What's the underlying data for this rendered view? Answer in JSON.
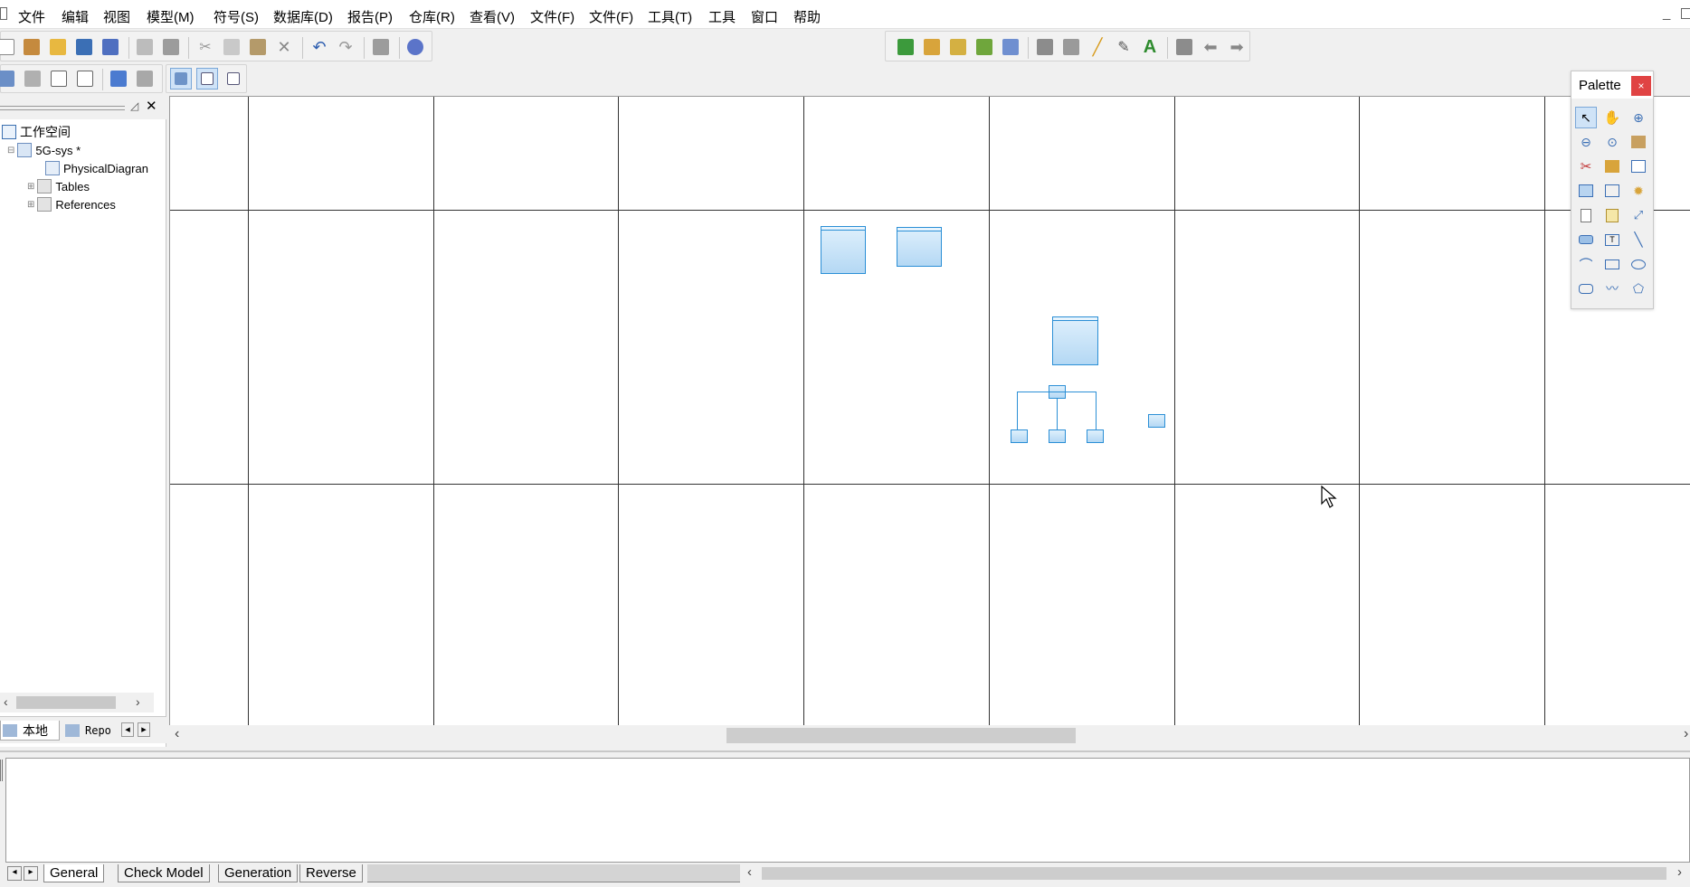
{
  "menu": {
    "items": [
      "文件",
      "编辑",
      "视图",
      "模型(M)",
      "符号(S)",
      "数据库(D)",
      "报告(P)",
      "仓库(R)",
      "查看(V)",
      "文件(F)",
      "文件(F)",
      "工具(T)",
      "工具",
      "窗口",
      "帮助"
    ],
    "minimize": "_"
  },
  "browser": {
    "tree": {
      "workspace": "工作空间",
      "model": "5G-sys *",
      "diagram": "PhysicalDiagran",
      "tables": "Tables",
      "references": "References"
    },
    "tabs": {
      "local": "本地",
      "repo": "Repo"
    }
  },
  "palette": {
    "title": "Palette",
    "close": "×"
  },
  "output": {
    "tabs": [
      "General",
      "Check Model",
      "Generation",
      "Reverse"
    ]
  },
  "colors": {
    "table_border": "#2b8fd6",
    "table_fill": "#cfe7f9",
    "palette_close": "#e04343"
  },
  "icons": {
    "toolbar1_left": [
      "new-icon",
      "new-model-icon",
      "open-icon",
      "save-icon",
      "save-all-icon",
      "print-preview-icon",
      "print-icon",
      "cut-icon",
      "copy-icon",
      "paste-icon",
      "delete-icon",
      "undo-icon",
      "redo-icon",
      "properties-icon",
      "checkout-icon"
    ],
    "toolbar1_right": [
      "add-table-icon",
      "add-view-icon",
      "add-procedure-icon",
      "refresh-icon",
      "check-icon",
      "fill-icon",
      "shadow-icon",
      "pen-icon",
      "brush-icon",
      "font-icon",
      "align-icon",
      "arrow-left-icon",
      "arrow-right-icon"
    ],
    "toolbar2": [
      "tb2-icon-1",
      "tb2-icon-2",
      "tb2-icon-3",
      "tb2-icon-4",
      "tb2-icon-5",
      "tb2-icon-6",
      "find-icon",
      "list-icon",
      "grid-icon"
    ],
    "palette": [
      "pointer-icon",
      "hand-icon",
      "zoom-in-icon",
      "zoom-out-icon",
      "zoom-fit-icon",
      "open-package-icon",
      "cut-tool-icon",
      "package-icon",
      "table-tool-icon",
      "view-tool-icon",
      "reference-tool-icon",
      "procedure-tool-icon",
      "file-tool-icon",
      "note-tool-icon",
      "link-tool-icon",
      "storage-tool-icon",
      "title-tool-icon",
      "line-tool-icon",
      "arc-tool-icon",
      "rectangle-tool-icon",
      "ellipse-tool-icon",
      "rounded-rect-tool-icon",
      "polyline-tool-icon",
      "polygon-tool-icon"
    ]
  }
}
